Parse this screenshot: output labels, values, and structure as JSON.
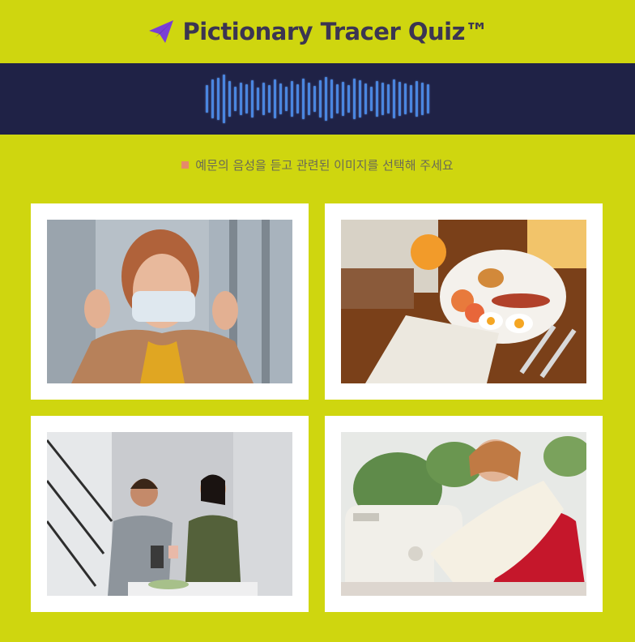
{
  "header": {
    "title": "Pictionary Tracer Quiz™"
  },
  "audio": {
    "icon": "waveform"
  },
  "instruction": {
    "text": "예문의 음성을 듣고 관련된 이미지를 선택해 주세요"
  },
  "options": [
    {
      "id": 1,
      "image": "woman-putting-on-face-mask"
    },
    {
      "id": 2,
      "image": "breakfast-plate-with-newspaper"
    },
    {
      "id": 3,
      "image": "couple-drinking-coffee-in-kitchen"
    },
    {
      "id": 4,
      "image": "woman-sewing-at-machine"
    }
  ],
  "colors": {
    "background": "#cfd60f",
    "audio_bar": "#1f2246",
    "wave": "#4a86e0",
    "logo": "#7a3fd6"
  }
}
